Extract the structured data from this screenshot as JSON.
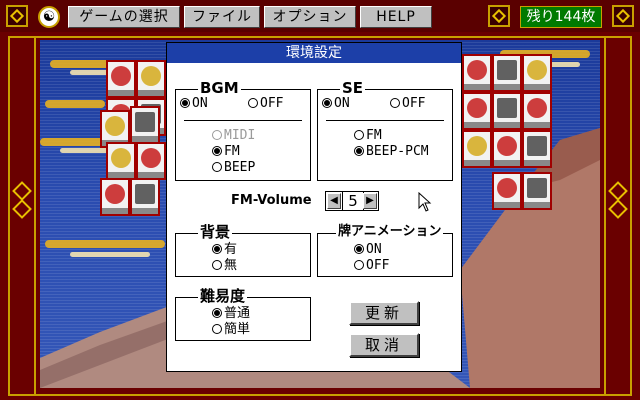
{
  "menubar": {
    "items": [
      "ゲームの選択",
      "ファイル",
      "オプション",
      "HELP"
    ],
    "remaining": "残り144枚",
    "logo_icon": "yin-yang-icon"
  },
  "dialog": {
    "title": "環境設定",
    "bgm": {
      "label": "BGM",
      "on": "ON",
      "off": "OFF",
      "selected": "ON",
      "sources": [
        "MIDI",
        "FM",
        "BEEP"
      ],
      "source_selected": "FM",
      "source_disabled": "MIDI"
    },
    "se": {
      "label": "SE",
      "on": "ON",
      "off": "OFF",
      "selected": "ON",
      "sources": [
        "FM",
        "BEEP-PCM"
      ],
      "source_selected": "BEEP-PCM"
    },
    "fm_volume": {
      "label": "FM-Volume",
      "value": "5"
    },
    "background": {
      "label": "背景",
      "options": [
        "有",
        "無"
      ],
      "selected": "有"
    },
    "tile_anim": {
      "label": "牌アニメーション",
      "options": [
        "ON",
        "OFF"
      ],
      "selected": "ON"
    },
    "difficulty": {
      "label": "難易度",
      "options": [
        "普通",
        "簡単"
      ],
      "selected": "普通"
    },
    "buttons": {
      "update": "更新",
      "cancel": "取消"
    }
  },
  "colors": {
    "frame": "#6a0000",
    "gold": "#c8a000",
    "title_bar": "#1c3fa8",
    "counter_bg": "#007a00"
  }
}
